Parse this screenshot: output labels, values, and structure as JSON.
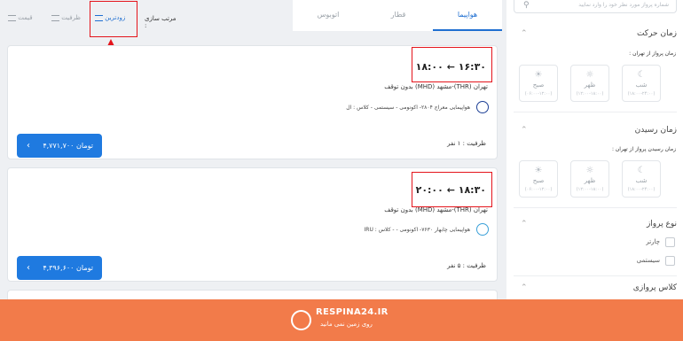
{
  "search": {
    "placeholder": "شماره پرواز مورد نظر خود را وارد نمایید"
  },
  "filters": {
    "departure": {
      "title": "زمان حرکت",
      "subtitle": "زمان پرواز از تهران :",
      "slots": [
        {
          "name": "شب",
          "range": "(۱۸:۰۰-۲۴:۰۰)",
          "icon": "moon-icon"
        },
        {
          "name": "ظهر",
          "range": "(۱۲:۰۰-۱۸:۰۰)",
          "icon": "sun-icon"
        },
        {
          "name": "صبح",
          "range": "(۰۶:۰۰-۱۲:۰۰)",
          "icon": "sunrise-icon"
        }
      ]
    },
    "arrival": {
      "title": "زمان رسیدن",
      "subtitle": "زمان رسیدن پرواز از تهران :",
      "slots": [
        {
          "name": "شب",
          "range": "(۱۸:۰۰-۲۴:۰۰)",
          "icon": "moon-icon"
        },
        {
          "name": "ظهر",
          "range": "(۱۲:۰۰-۱۸:۰۰)",
          "icon": "sun-icon"
        },
        {
          "name": "صبح",
          "range": "(۰۶:۰۰-۱۲:۰۰)",
          "icon": "sunrise-icon"
        }
      ]
    },
    "flight_type": {
      "title": "نوع پرواز",
      "options": [
        "چارتر",
        "سیستمی"
      ]
    },
    "flight_class": {
      "title": "کلاس پروازی"
    }
  },
  "tabs": [
    {
      "label": "هواپیما",
      "active": true
    },
    {
      "label": "قطار",
      "active": false
    },
    {
      "label": "اتوبوس",
      "active": false
    }
  ],
  "sort": {
    "label": "مرتب سازی :",
    "options": [
      {
        "label": "زودترین",
        "active": true
      },
      {
        "label": "ظرفیت",
        "active": false
      },
      {
        "label": "قیمت",
        "active": false
      }
    ]
  },
  "flights": [
    {
      "times": "۱۸:۰۰ ← ۱۶:۳۰",
      "route": "تهران (THR)-مشهد (MHD)   بدون توقف",
      "airline": "هواپیمایی معراج ۲۸۰۴-   اکونومی - سیستمی - کلاس : ال",
      "capacity": "ظرفیت : ۱ نفر",
      "price": "۴,۷۷۱,۷۰۰  تومان"
    },
    {
      "times": "۲۰:۰۰ ← ۱۸:۳۰",
      "route": "تهران (THR)-مشهد (MHD)   بدون توقف",
      "airline": "هواپیمایی چابهار ۷۶۳۰-  اکونومی - - کلاس : IRU",
      "capacity": "ظرفیت : ۵ نفر",
      "price": "۴,۳۹۶,۶۰۰  تومان"
    }
  ],
  "banner": {
    "brand": "RESPINA24.IR",
    "tagline": "روی زمین نمی مانید"
  },
  "colors": {
    "accent": "#1f7ae0",
    "highlight": "#e4141b",
    "banner": "#f27b4a"
  }
}
